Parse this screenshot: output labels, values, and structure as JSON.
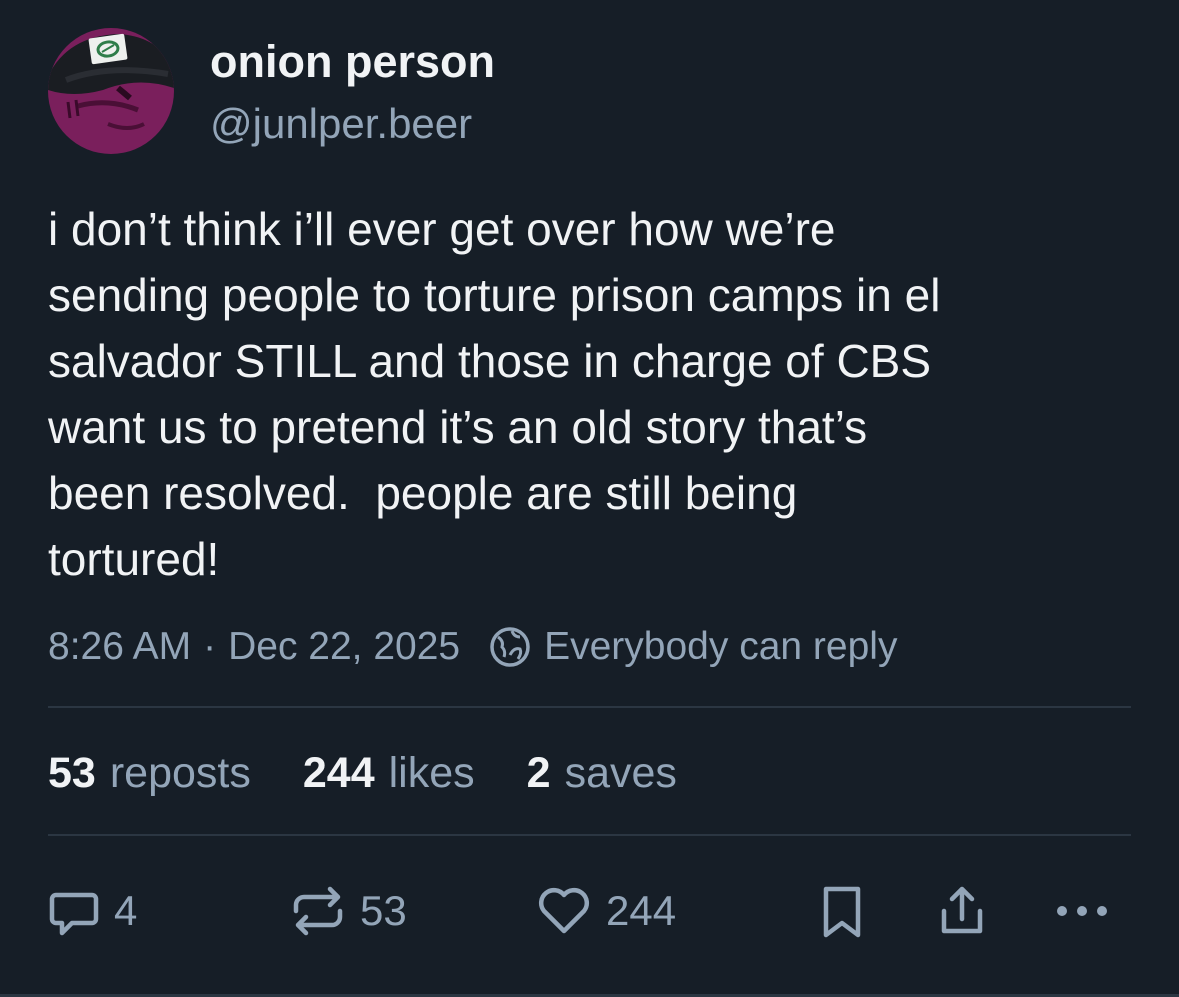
{
  "post": {
    "author": {
      "display_name": "onion person",
      "handle": "@junlper.beer"
    },
    "text": "i don’t think i’ll ever get over how we’re\nsending people to torture prison camps in el\nsalvador STILL and those in charge of CBS\nwant us to pretend it’s an old story that’s\nbeen resolved.  people are still being\ntortured!",
    "time": "8:26 AM",
    "separator": "·",
    "date": "Dec 22, 2025",
    "reply_setting": "Everybody can reply"
  },
  "stats": {
    "reposts": {
      "count": "53",
      "label": "reposts"
    },
    "likes": {
      "count": "244",
      "label": "likes"
    },
    "saves": {
      "count": "2",
      "label": "saves"
    }
  },
  "actions": {
    "reply_count": "4",
    "repost_count": "53",
    "like_count": "244",
    "icons": [
      "reply-icon",
      "repost-icon",
      "like-icon",
      "bookmark-icon",
      "share-icon",
      "more-icon"
    ]
  },
  "colors": {
    "background": "#161e27",
    "text_primary": "#f1f3f5",
    "text_secondary": "#93a5b8",
    "divider": "#2b3642",
    "avatar_purple": "#7a1f5c"
  }
}
